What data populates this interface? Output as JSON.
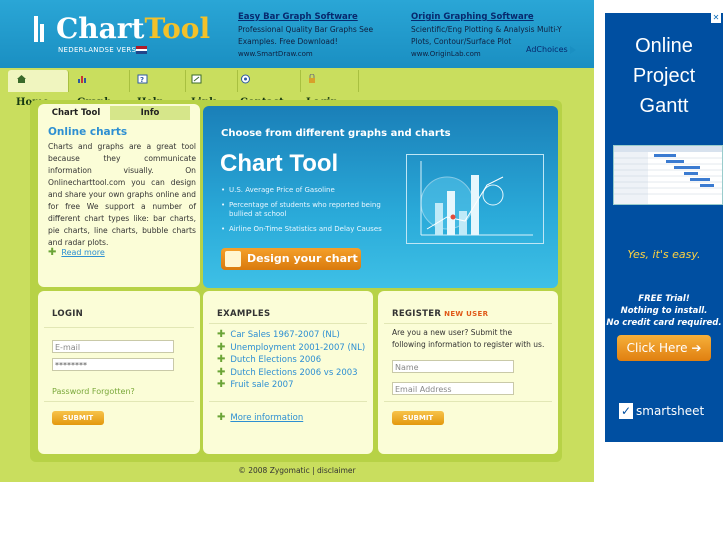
{
  "header": {
    "brand_part1": "Chart",
    "brand_part2": "Tool",
    "version_link": "NEDERLANDSE VERSIE",
    "ads": [
      {
        "title": "Easy Bar Graph Software",
        "description": "Professional Quality Bar Graphs See Examples. Free Download!",
        "url": "www.SmartDraw.com"
      },
      {
        "title": "Origin Graphing Software",
        "description": "Scientific/Eng Plotting & Analysis Multi-Y Plots, Contour/Surface Plot",
        "url": "www.OriginLab.com"
      }
    ],
    "adchoices": "AdChoices"
  },
  "nav": {
    "items": [
      {
        "label": "Home",
        "icon": "home-icon"
      },
      {
        "label": "Graph",
        "icon": "graph-icon"
      },
      {
        "label": "Help",
        "icon": "help-icon"
      },
      {
        "label": "Link",
        "icon": "link-icon"
      },
      {
        "label": "Contact",
        "icon": "contact-icon"
      },
      {
        "label": "Login",
        "icon": "login-icon"
      }
    ],
    "active": "Home"
  },
  "intro": {
    "tabs": [
      "Chart Tool",
      "Info"
    ],
    "heading": "Online charts",
    "body": "Charts and graphs are a great tool because they communicate information visually. On Onlinecharttool.com you can design and share your own graphs online and for free We support a number of different chart types like: bar charts, pie charts, line charts, bubble charts and radar plots.",
    "more": "Read more"
  },
  "hero": {
    "heading": "Choose from different graphs and charts",
    "title": "Chart Tool",
    "bullets": [
      "U.S. Average Price of Gasoline",
      "Percentage of students who reported being bullied at school",
      "Airline On-Time Statistics and Delay Causes"
    ],
    "cta": "Design your chart"
  },
  "login": {
    "heading": "LOGIN",
    "email_placeholder": "E-mail",
    "password_value": "********",
    "forgot": "Password Forgotten?",
    "submit": "SUBMIT"
  },
  "examples": {
    "heading": "EXAMPLES",
    "items": [
      "Car Sales 1967-2007 (NL)",
      "Unemployment 2001-2007 (NL)",
      "Dutch Elections 2006",
      "Dutch Elections 2006 vs 2003",
      "Fruit sale 2007"
    ],
    "more": "More information"
  },
  "register": {
    "heading": "REGISTER",
    "badge": "NEW USER",
    "text": "Are you a new user? Submit the following information to register with us.",
    "name_placeholder": "Name",
    "email_placeholder": "Email Address",
    "submit": "SUBMIT"
  },
  "footer": {
    "text": "© 2008 Zygomatic | disclaimer"
  },
  "side_ad": {
    "title_line1": "Online",
    "title_line2": "Project",
    "title_line3": "Gantt",
    "tagline": "Yes, it's easy.",
    "trial_line1": "FREE Trial!",
    "trial_line2": "Nothing to install.",
    "trial_line3": "No credit card required.",
    "button": "Click Here",
    "brand": "smartsheet"
  },
  "colors": {
    "page_bg": "#c9de5e",
    "header_bg": "#1a8fc2",
    "link": "#2d8fd2",
    "logo_accent": "#f3c12a",
    "cta": "#e58a14",
    "side_ad_bg": "#004fa1"
  }
}
